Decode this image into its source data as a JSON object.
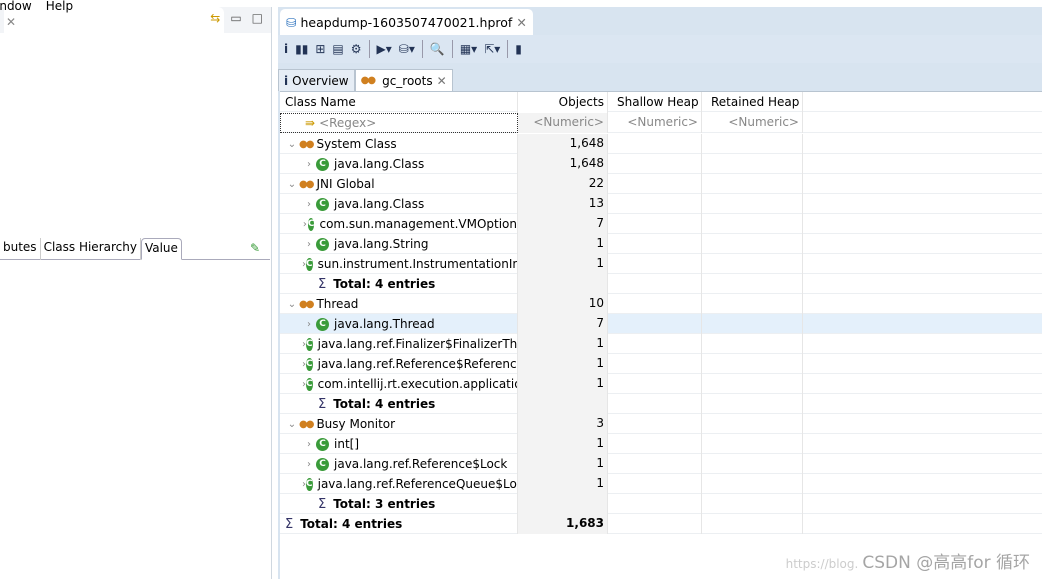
{
  "menubar": [
    "indow",
    "Help"
  ],
  "left_panel": {
    "tabs": [
      "butes",
      "Class Hierarchy",
      "Value"
    ],
    "active_tab": "Value"
  },
  "editor": {
    "title": "heapdump-1603507470021.hprof",
    "subtabs": [
      {
        "label": "Overview",
        "icon": "info-icon"
      },
      {
        "label": "gc_roots",
        "icon": "gc-roots-icon"
      }
    ],
    "active_subtab": "gc_roots"
  },
  "table": {
    "columns": [
      "Class Name",
      "Objects",
      "Shallow Heap",
      "Retained Heap"
    ],
    "filters": [
      "<Regex>",
      "<Numeric>",
      "<Numeric>",
      "<Numeric>"
    ],
    "rows": [
      {
        "level": 0,
        "type": "group",
        "expanded": true,
        "name": "System Class",
        "objects": "1,648"
      },
      {
        "level": 1,
        "type": "class",
        "name": "java.lang.Class",
        "objects": "1,648"
      },
      {
        "level": 0,
        "type": "group",
        "expanded": true,
        "name": "JNI Global",
        "objects": "22"
      },
      {
        "level": 1,
        "type": "class",
        "name": "java.lang.Class",
        "objects": "13"
      },
      {
        "level": 1,
        "type": "class",
        "name": "com.sun.management.VMOption",
        "objects": "7"
      },
      {
        "level": 1,
        "type": "class",
        "name": "java.lang.String",
        "objects": "1"
      },
      {
        "level": 1,
        "type": "class",
        "name": "sun.instrument.InstrumentationImpl",
        "objects": "1"
      },
      {
        "level": 1,
        "type": "total",
        "name": "Total: 4 entries",
        "objects": ""
      },
      {
        "level": 0,
        "type": "group",
        "expanded": true,
        "name": "Thread",
        "objects": "10"
      },
      {
        "level": 1,
        "type": "class",
        "name": "java.lang.Thread",
        "objects": "7",
        "selected": true
      },
      {
        "level": 1,
        "type": "class",
        "name": "java.lang.ref.Finalizer$FinalizerThread",
        "objects": "1"
      },
      {
        "level": 1,
        "type": "class",
        "name": "java.lang.ref.Reference$ReferenceHandler",
        "objects": "1"
      },
      {
        "level": 1,
        "type": "class",
        "name": "com.intellij.rt.execution.application",
        "objects": "1"
      },
      {
        "level": 1,
        "type": "total",
        "name": "Total: 4 entries",
        "objects": ""
      },
      {
        "level": 0,
        "type": "group",
        "expanded": true,
        "name": "Busy Monitor",
        "objects": "3"
      },
      {
        "level": 1,
        "type": "class",
        "name": "int[]",
        "objects": "1"
      },
      {
        "level": 1,
        "type": "class",
        "name": "java.lang.ref.Reference$Lock",
        "objects": "1"
      },
      {
        "level": 1,
        "type": "class",
        "name": "java.lang.ref.ReferenceQueue$Lock",
        "objects": "1"
      },
      {
        "level": 1,
        "type": "total",
        "name": "Total: 3 entries",
        "objects": ""
      },
      {
        "level": 0,
        "type": "total",
        "name": "Total: 4 entries",
        "objects": "1,683"
      }
    ]
  },
  "watermark": {
    "faint": "https://blog.",
    "text": "CSDN @高高for 循环"
  }
}
